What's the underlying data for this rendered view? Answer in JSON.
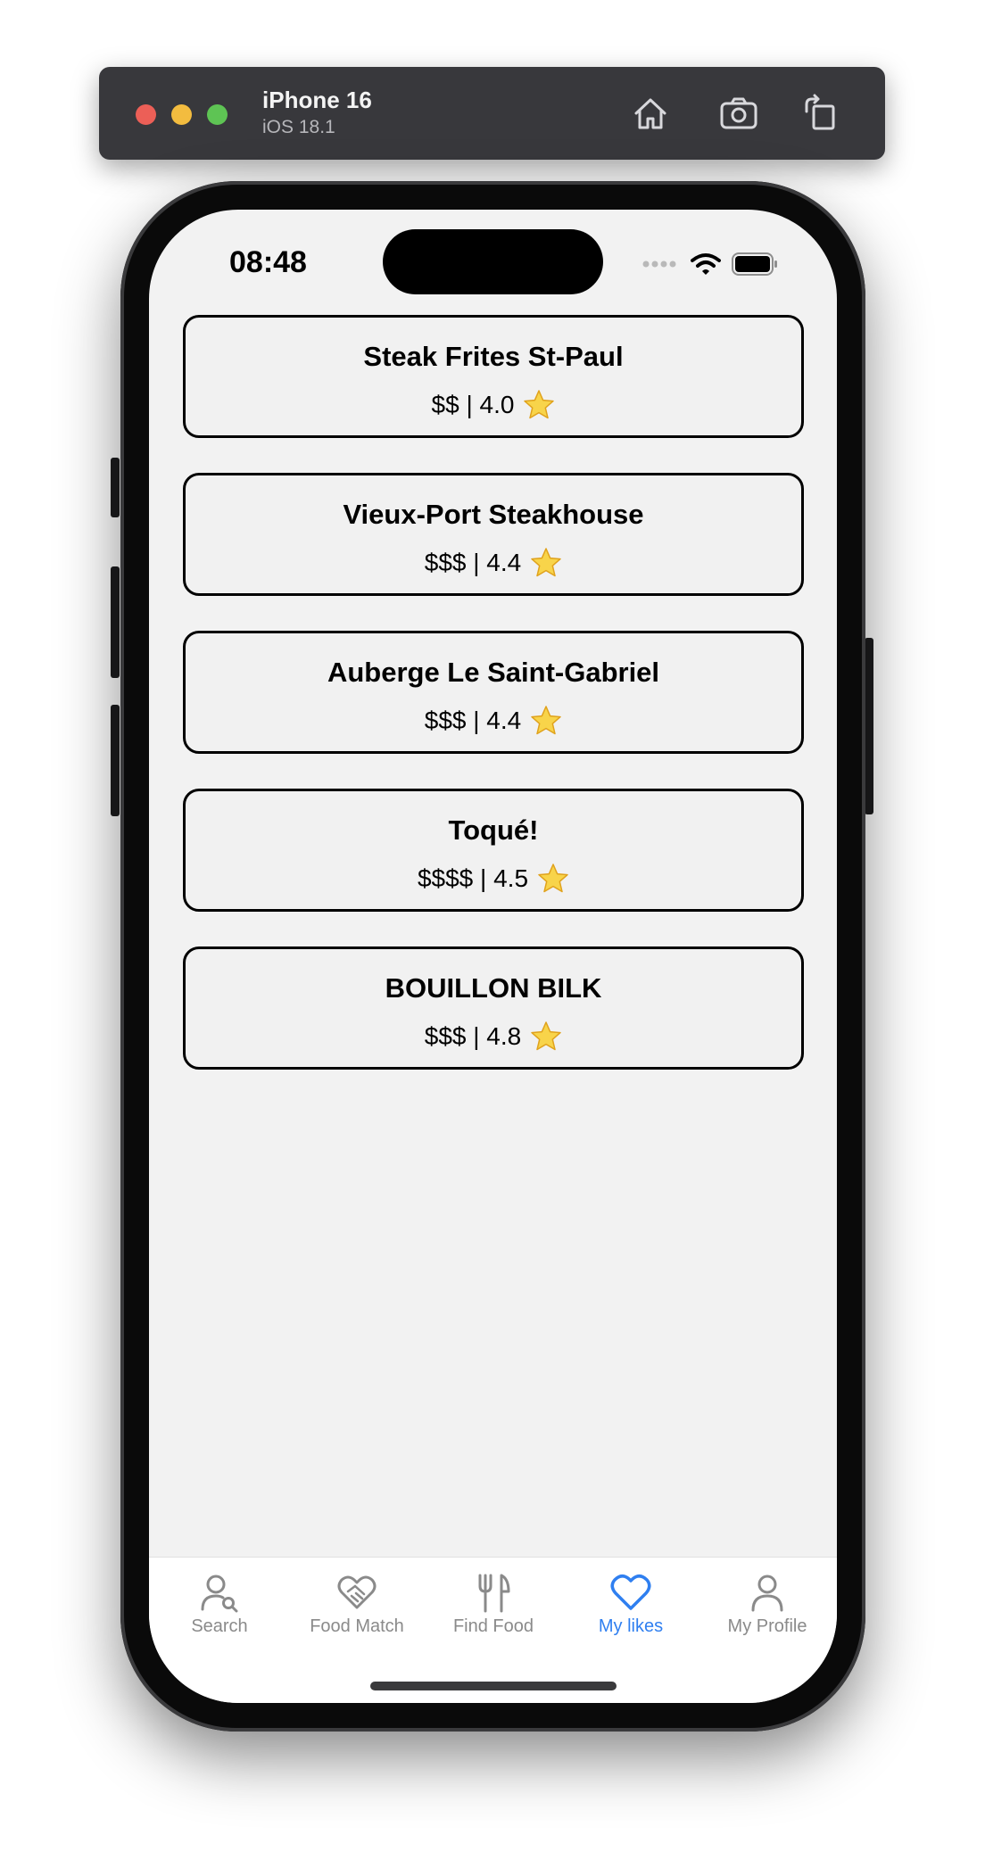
{
  "simulator": {
    "device": "iPhone 16",
    "os": "iOS 18.1",
    "toolbar": {
      "home_icon": "home-icon",
      "screenshot_icon": "camera-icon",
      "rotate_icon": "rotate-icon"
    }
  },
  "status_bar": {
    "time": "08:48"
  },
  "likes": [
    {
      "name": "Steak Frites St-Paul",
      "meta": "$$ | 4.0"
    },
    {
      "name": "Vieux-Port Steakhouse",
      "meta": "$$$ | 4.4"
    },
    {
      "name": "Auberge Le Saint-Gabriel",
      "meta": "$$$ | 4.4"
    },
    {
      "name": "Toqué!",
      "meta": "$$$$ | 4.5"
    },
    {
      "name": "BOUILLON BILK",
      "meta": "$$$ | 4.8"
    }
  ],
  "tabs": [
    {
      "label": "Search",
      "icon": "person-search-icon"
    },
    {
      "label": "Food Match",
      "icon": "handshake-heart-icon"
    },
    {
      "label": "Find Food",
      "icon": "fork-knife-icon"
    },
    {
      "label": "My likes",
      "icon": "heart-icon",
      "active": true
    },
    {
      "label": "My Profile",
      "icon": "person-icon"
    }
  ],
  "colors": {
    "accent": "#2f7ff0",
    "inactive": "#8a8a8a",
    "star": "#f5c518"
  }
}
